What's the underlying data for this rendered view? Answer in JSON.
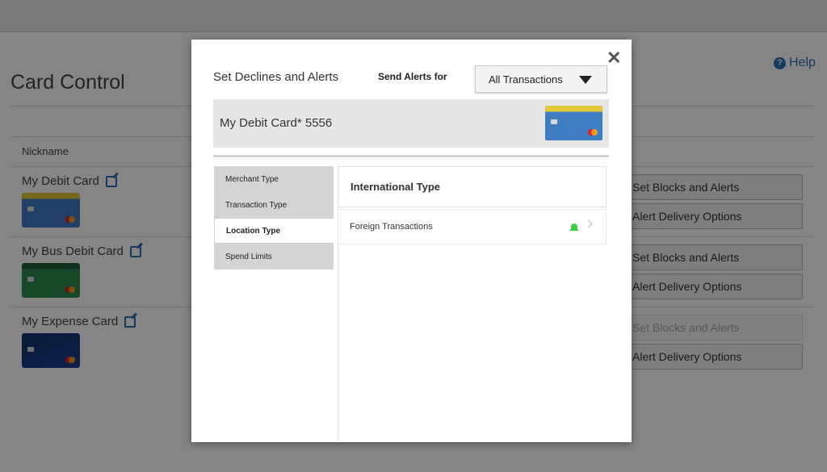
{
  "page": {
    "title": "Card Control",
    "help_label": "Help",
    "help_icon": "question-circle-icon",
    "nickname_header": "Nickname"
  },
  "cards": [
    {
      "name": "My Debit Card",
      "style": "blue"
    },
    {
      "name": "My Bus Debit Card",
      "style": "green"
    },
    {
      "name": "My Expense Card",
      "style": "navy"
    }
  ],
  "actions": {
    "blocks_label": "Set Blocks and Alerts",
    "delivery_label": "Alert Delivery Options"
  },
  "modal": {
    "title": "Set Declines and Alerts",
    "send_alerts_label": "Send Alerts for",
    "select_value": "All Transactions",
    "selected_card": "My Debit Card* 5556",
    "tabs": [
      {
        "label": "Merchant Type",
        "active": false
      },
      {
        "label": "Transaction Type",
        "active": false
      },
      {
        "label": "Location Type",
        "active": true
      },
      {
        "label": "Spend Limits",
        "active": false
      }
    ],
    "section_title": "International Type",
    "rows": [
      {
        "label": "Foreign Transactions",
        "alert_on": true
      }
    ]
  },
  "colors": {
    "accent_blue": "#2a6fb5",
    "alert_green": "#3ecf3e",
    "overlay": "rgba(0,0,0,0.48)"
  }
}
